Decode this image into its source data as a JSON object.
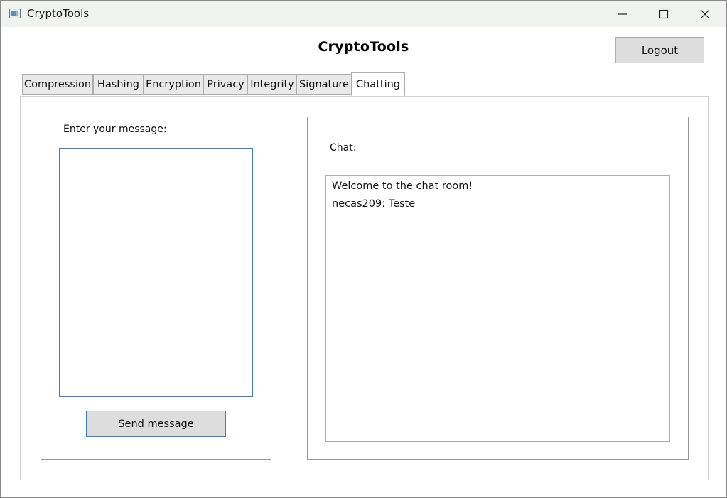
{
  "window": {
    "title": "CryptoTools",
    "controls": {
      "minimize": "minimize-icon",
      "maximize": "maximize-icon",
      "close": "close-icon"
    }
  },
  "header": {
    "title": "CryptoTools",
    "logout_label": "Logout"
  },
  "tabs": [
    {
      "label": "Compression",
      "active": false
    },
    {
      "label": "Hashing",
      "active": false
    },
    {
      "label": "Encryption",
      "active": false
    },
    {
      "label": "Privacy",
      "active": false
    },
    {
      "label": "Integrity",
      "active": false
    },
    {
      "label": "Signature",
      "active": false
    },
    {
      "label": "Chatting",
      "active": true
    }
  ],
  "compose": {
    "label": "Enter your message:",
    "value": "",
    "send_label": "Send message"
  },
  "chat": {
    "label": "Chat:",
    "messages": [
      "Welcome to the chat room!",
      "necas209: Teste"
    ]
  },
  "colors": {
    "titlebar_bg": "#f0f3ef",
    "button_bg": "#dddddd",
    "focus_border": "#3c7fc7"
  }
}
